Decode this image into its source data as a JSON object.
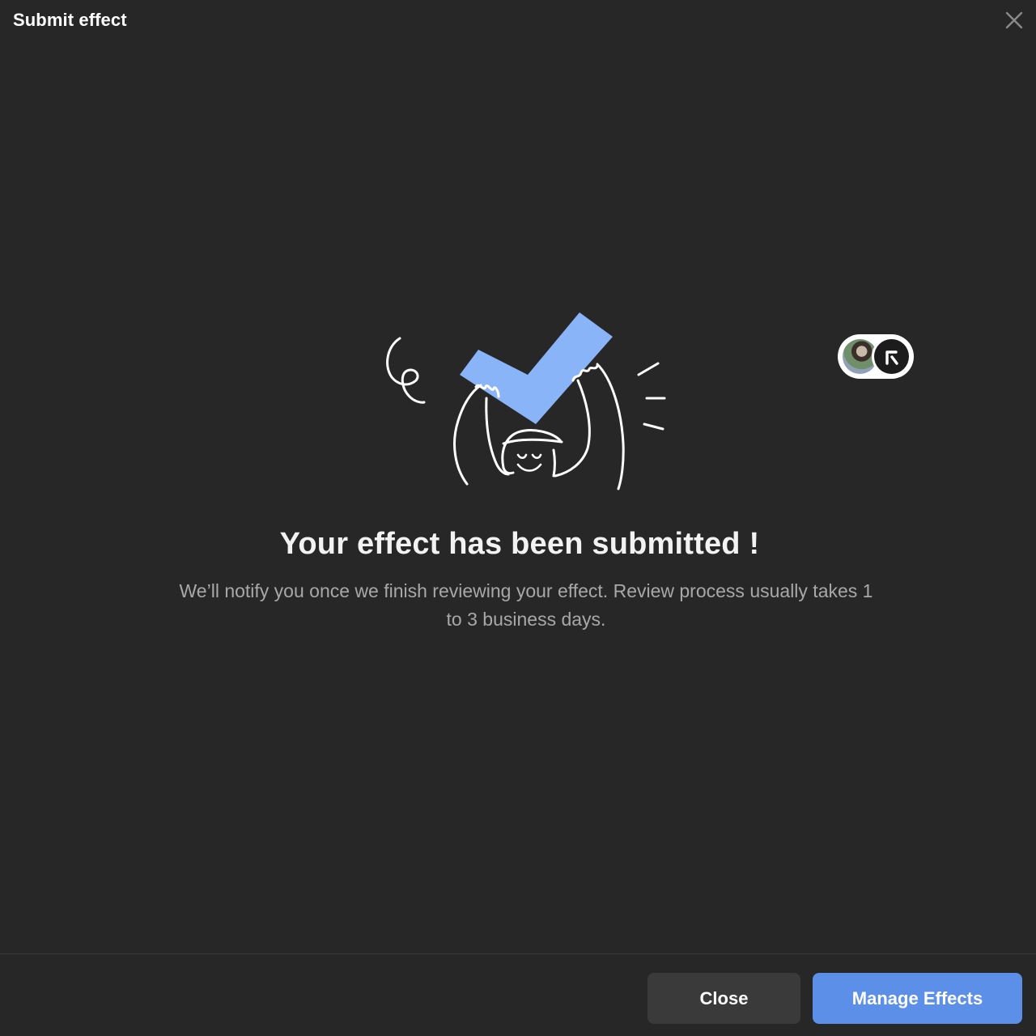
{
  "header": {
    "title": "Submit effect",
    "close_icon": "close-icon"
  },
  "illustration": {
    "icon": "checkmark-celebration-illustration",
    "accent_color": "#8ab4f8",
    "line_color": "#ffffff"
  },
  "avatars": {
    "icon_first": "user-avatar",
    "icon_second": "brand-logo-avatar"
  },
  "main": {
    "headline": "Your effect has been submitted !",
    "description": "We’ll notify you once we finish reviewing your effect. Review process usually takes 1 to 3 business days."
  },
  "footer": {
    "close_label": "Close",
    "manage_label": "Manage Effects",
    "primary_color": "#5b8fe8"
  }
}
